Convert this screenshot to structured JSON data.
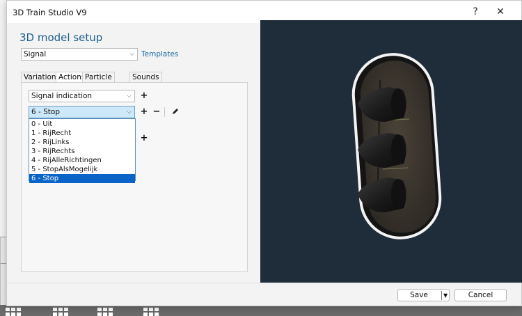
{
  "window": {
    "title": "3D Train Studio V9"
  },
  "titlebar": {
    "help_glyph": "?",
    "close_glyph": "✕"
  },
  "panel": {
    "heading": "3D model setup"
  },
  "model_type": {
    "value": "Signal"
  },
  "templates_link": "Templates",
  "tabs": [
    {
      "label": "Variations",
      "selected": false
    },
    {
      "label": "Actions",
      "selected": true
    },
    {
      "label": "Particle effects",
      "selected": false
    },
    {
      "label": "Sounds",
      "selected": false
    }
  ],
  "actions": {
    "action_value": "Signal indication",
    "state_value": "6 - Stop",
    "options": [
      "0 - Uit",
      "1 - RijRecht",
      "2 - RijLinks",
      "3 - RijRechts",
      "4 - RijAlleRichtingen",
      "5 - StopAlsMogelijk",
      "6 - Stop"
    ],
    "selected_option": "6 - Stop"
  },
  "footer": {
    "save_label": "Save",
    "cancel_label": "Cancel"
  },
  "colors": {
    "heading": "#1d5f8a",
    "link": "#1d6fa5",
    "viewport_bg": "#1e2d39",
    "selection": "#0a64c8",
    "active_combo": "#cde8fb"
  }
}
